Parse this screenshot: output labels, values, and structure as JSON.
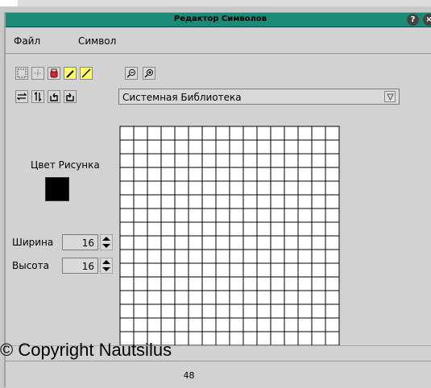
{
  "window": {
    "title": "Редактор Символов",
    "help_glyph": "?",
    "close_glyph": "×"
  },
  "menu": {
    "file": "Файл",
    "symbol": "Символ"
  },
  "toolbar": {
    "tools": [
      "select-rect-icon",
      "move-icon",
      "eraser-icon",
      "pencil-icon",
      "line-icon"
    ],
    "zoom": [
      "zoom-out-icon",
      "zoom-in-icon"
    ],
    "transforms": [
      "flip-horizontal-icon",
      "flip-vertical-icon",
      "rotate-left-icon",
      "rotate-right-icon"
    ]
  },
  "library": {
    "selected": "Системная Библиотека"
  },
  "left_panel": {
    "color_label": "Цвет Рисунка",
    "width_label": "Ширина",
    "width_value": "16",
    "height_label": "Высота",
    "height_value": "16"
  },
  "status": {
    "value": "48"
  },
  "watermark": "© Copyright Nautsilus",
  "colors": {
    "title_bar": "#1b8a77",
    "swatch": "#000000",
    "active_tool": "#ffff66"
  }
}
